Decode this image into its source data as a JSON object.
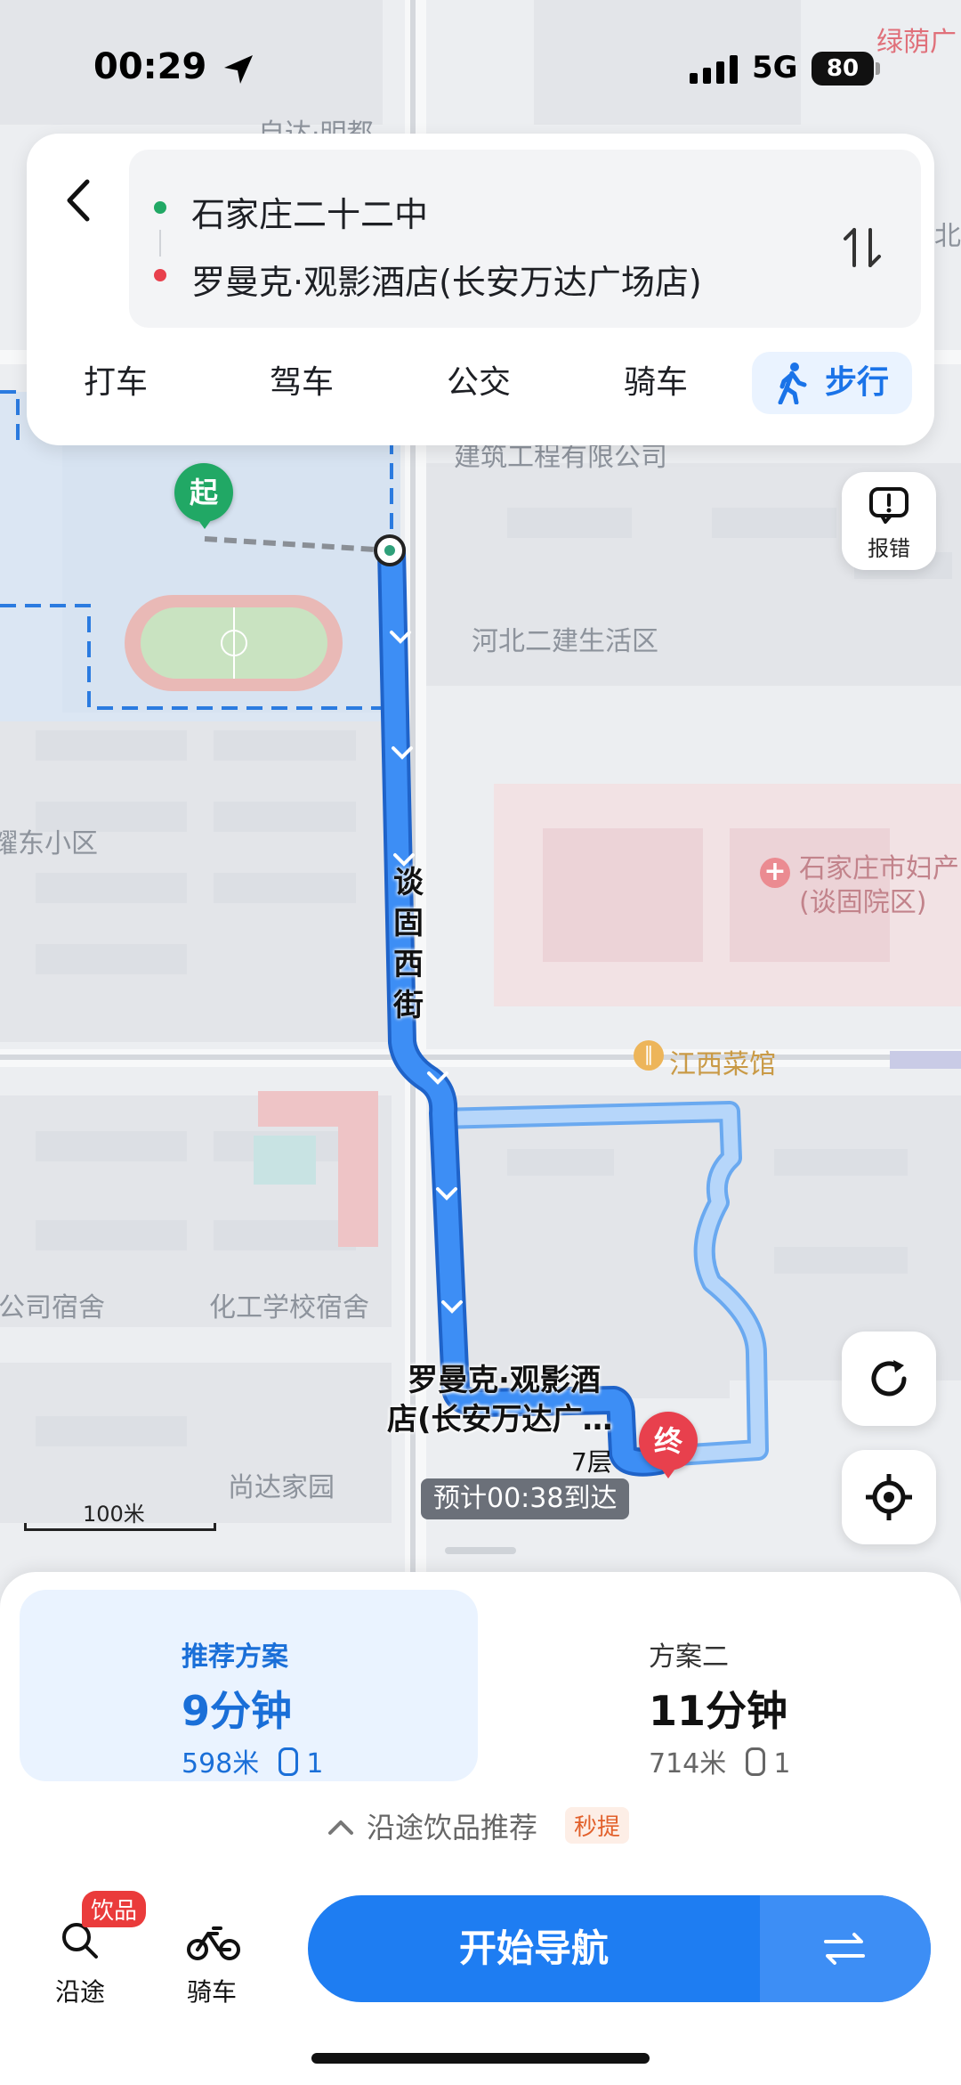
{
  "status_bar": {
    "time": "00:29",
    "network": "5G",
    "battery": "80"
  },
  "route": {
    "origin": "石家庄二十二中",
    "destination": "罗曼克·观影酒店(长安万达广场店)"
  },
  "modes": [
    "打车",
    "驾车",
    "公交",
    "骑车",
    "步行"
  ],
  "active_mode": "步行",
  "report_label": "报错",
  "map": {
    "labels": {
      "top_partial": "自达·明都",
      "green_partial": "绿荫广",
      "north_partial": "北",
      "company": "建筑工程有限公司",
      "hebei_erjian": "河北二建生活区",
      "east_community": "耀东小区",
      "hospital_name": "石家庄市妇产",
      "hospital_branch": "(谈固院区)",
      "restaurant": "江西菜馆",
      "company_dorm": "公司宿舍",
      "chem_school": "化工学校宿舍",
      "shangda": "尚达家园"
    },
    "street": [
      "谈",
      "固",
      "西",
      "街"
    ],
    "start_marker": "起",
    "end_marker": "终",
    "dest_label_line1": "罗曼克·观影酒",
    "dest_label_line2": "店(长安万达广…",
    "floor": "7层",
    "eta": "预计00:38到达",
    "scale": "100米"
  },
  "plans": [
    {
      "title": "推荐方案",
      "duration": "9分钟",
      "distance": "598米",
      "lights": "1"
    },
    {
      "title": "方案二",
      "duration": "11分钟",
      "distance": "714米",
      "lights": "1"
    }
  ],
  "drink_recommend": {
    "label": "沿途饮品推荐",
    "badge": "秒提"
  },
  "bottom_bar": {
    "along_label": "沿途",
    "along_badge": "饮品",
    "bike_label": "骑车",
    "start_nav": "开始导航"
  },
  "colors": {
    "accent": "#1e7df2",
    "route": "#3d8ef5",
    "alt_route": "#a9cdf7",
    "start_green": "#21a865",
    "end_red": "#e8404d"
  }
}
